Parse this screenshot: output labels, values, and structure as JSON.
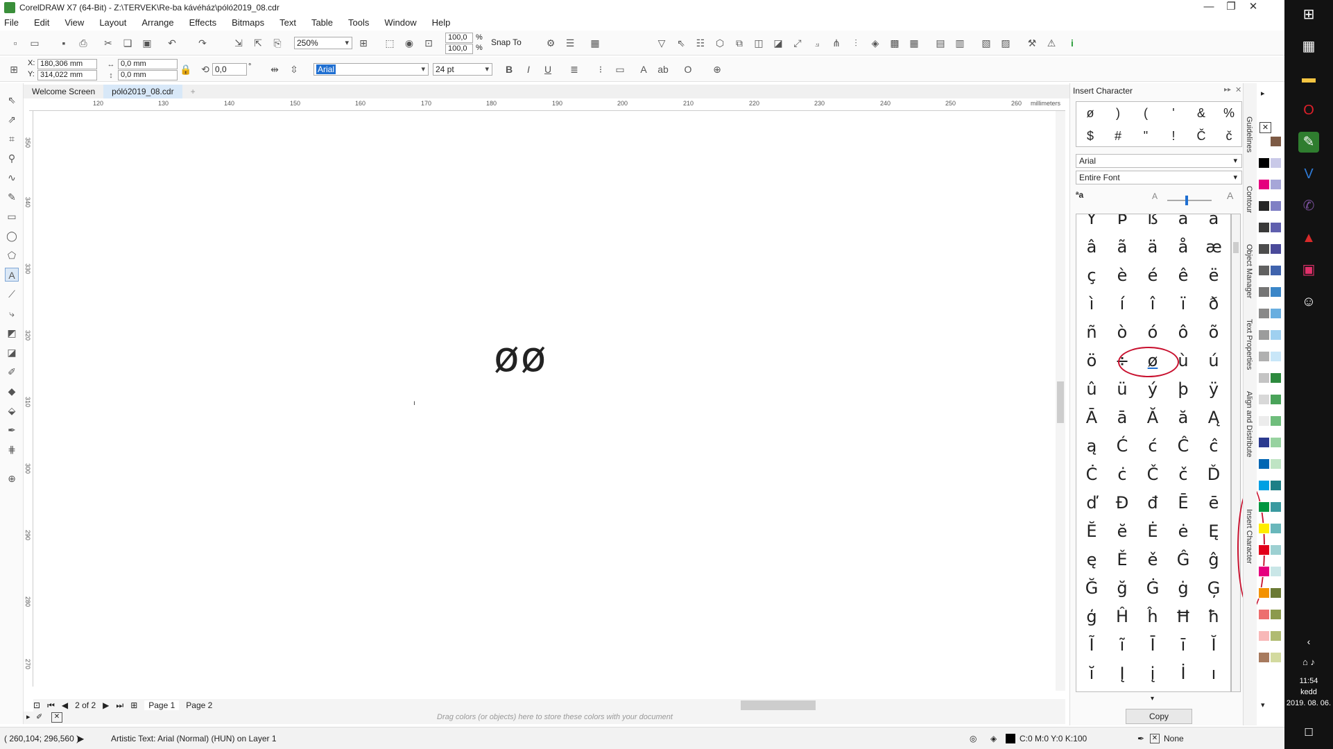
{
  "app": {
    "title": "CorelDRAW X7 (64-Bit) - Z:\\TERVEK\\Re-ba kávéház\\póló2019_08.cdr"
  },
  "menu": [
    "File",
    "Edit",
    "View",
    "Layout",
    "Arrange",
    "Effects",
    "Bitmaps",
    "Text",
    "Table",
    "Tools",
    "Window",
    "Help"
  ],
  "toolbar": {
    "zoom": "250%",
    "scale_w": "100,0",
    "scale_h": "100,0",
    "pct": "%",
    "snap_to": "Snap To"
  },
  "property_bar": {
    "x": "180,306 mm",
    "y": "314,022 mm",
    "x_label": "X:",
    "y_label": "Y:",
    "w": "0,0 mm",
    "h": "0,0 mm",
    "rotation": "0,0",
    "degree": "°",
    "font": "Arial",
    "size": "24 pt"
  },
  "tabs": {
    "welcome": "Welcome Screen",
    "doc": "póló2019_08.cdr",
    "add": "+"
  },
  "ruler": {
    "units": "millimeters",
    "h_ticks": [
      "120",
      "130",
      "140",
      "150",
      "160",
      "170",
      "180",
      "190",
      "200",
      "210",
      "220",
      "230",
      "240",
      "250",
      "260"
    ],
    "v_ticks": [
      "350",
      "340",
      "330",
      "320",
      "310",
      "300",
      "290",
      "280",
      "270"
    ]
  },
  "canvas": {
    "text": "øø",
    "cursor": "ı"
  },
  "pages": {
    "counter": "2 of 2",
    "page1": "Page 1",
    "page2": "Page 2"
  },
  "palette_hint": "Drag colors (or objects) here to store these colors with your document",
  "status": {
    "coords": "( 260,104; 296,560 )",
    "info": "Artistic Text: Arial (Normal) (HUN) on Layer 1",
    "fill": "C:0 M:0 Y:0 K:100",
    "outline": "None"
  },
  "panel": {
    "title": "Insert Character",
    "recent": [
      "ø",
      ")",
      "(",
      "'",
      "&",
      "%",
      "$",
      "#",
      "\"",
      "!",
      "Č",
      "č"
    ],
    "font": "Arial",
    "range": "Entire Font",
    "grid": [
      [
        "Ÿ",
        "Þ",
        "ß",
        "à",
        "á"
      ],
      [
        "â",
        "ã",
        "ä",
        "å",
        "æ"
      ],
      [
        "ç",
        "è",
        "é",
        "ê",
        "ë"
      ],
      [
        "ì",
        "í",
        "î",
        "ï",
        "ð"
      ],
      [
        "ñ",
        "ò",
        "ó",
        "ô",
        "õ"
      ],
      [
        "ö",
        "÷",
        "ø",
        "ù",
        "ú"
      ],
      [
        "û",
        "ü",
        "ý",
        "þ",
        "ÿ"
      ],
      [
        "Ā",
        "ā",
        "Ă",
        "ă",
        "Ą"
      ],
      [
        "ą",
        "Ć",
        "ć",
        "Ĉ",
        "ĉ"
      ],
      [
        "Ċ",
        "ċ",
        "Č",
        "č",
        "Ď"
      ],
      [
        "ď",
        "Đ",
        "đ",
        "Ē",
        "ē"
      ],
      [
        "Ĕ",
        "ĕ",
        "Ė",
        "ė",
        "Ę"
      ],
      [
        "ę",
        "Ě",
        "ě",
        "Ĝ",
        "ĝ"
      ],
      [
        "Ğ",
        "ğ",
        "Ġ",
        "ġ",
        "Ģ"
      ],
      [
        "ģ",
        "Ĥ",
        "ĥ",
        "Ħ",
        "ħ"
      ],
      [
        "Ĩ",
        "ĩ",
        "Ī",
        "ī",
        "Ĭ"
      ],
      [
        "ĭ",
        "Į",
        "į",
        "İ",
        "ı"
      ]
    ],
    "copy": "Copy"
  },
  "dockers": [
    "Guidelines",
    "Contour",
    "Object Manager",
    "Text Properties",
    "Align and Distribute",
    "Insert Character"
  ],
  "palette_colors": [
    "#ffffff",
    "#000000",
    "#e5007e",
    "#262626",
    "#3a3a3a",
    "#4d4d4d",
    "#616161",
    "#757575",
    "#898989",
    "#9c9c9c",
    "#b0b0b0",
    "#c4c4c4",
    "#d8d8d8",
    "#ececec",
    "#2b3a8f",
    "#0066b3",
    "#00a0e3",
    "#009640",
    "#ffed00",
    "#e2001a",
    "#e6007e",
    "#f39200",
    "#ed6f6f",
    "#f8b8b8",
    "#a77a5e",
    "#7d5a45",
    "#c9c9e8",
    "#a6a6d8",
    "#7f7fc4",
    "#5f5fae",
    "#4a4a9a",
    "#3f63ad",
    "#3b86c8",
    "#68aee0",
    "#9fd0f0",
    "#c8e6f8",
    "#2d8a3e",
    "#4aa35a",
    "#6fbd7c",
    "#97d2a0",
    "#bfe4c4",
    "#1e7f86",
    "#3a9aa0",
    "#69b7bb",
    "#9dd0d2",
    "#c9e6e7",
    "#6b7a35",
    "#8c9a4d",
    "#b0bb72",
    "#d3da9f"
  ],
  "taskbar": {
    "time": "11:54",
    "day": "kedd",
    "date": "2019. 08. 06."
  }
}
